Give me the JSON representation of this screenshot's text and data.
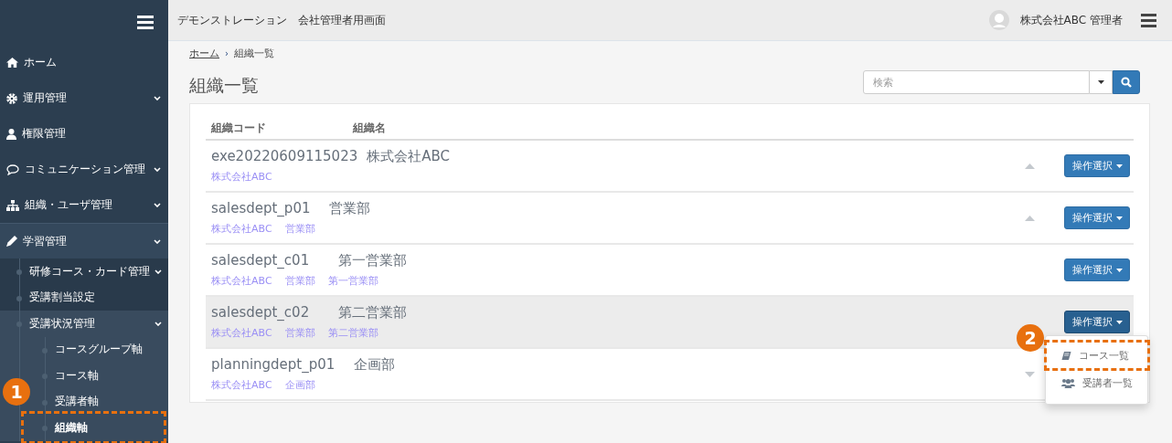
{
  "sidebar": {
    "items": [
      {
        "label": "ホーム"
      },
      {
        "label": "運用管理",
        "expanded": false
      },
      {
        "label": "権限管理"
      },
      {
        "label": "コミュニケーション管理",
        "expanded": false
      },
      {
        "label": "組織・ユーザ管理",
        "expanded": false
      },
      {
        "label": "学習管理",
        "expanded": true,
        "children": [
          {
            "label": "研修コース・カード管理",
            "expanded": false
          },
          {
            "label": "受講割当設定"
          },
          {
            "label": "受講状況管理",
            "expanded": true,
            "children": [
              {
                "label": "コースグループ軸",
                "selected": false
              },
              {
                "label": "コース軸",
                "selected": false
              },
              {
                "label": "受講者軸",
                "selected": false
              },
              {
                "label": "組織軸",
                "selected": true,
                "callout": "1"
              }
            ]
          }
        ]
      }
    ]
  },
  "header": {
    "title": "デモンストレーション",
    "subtitle": "会社管理者用画面",
    "user": "株式会社ABC 管理者"
  },
  "breadcrumb": {
    "link": "ホーム",
    "separator": "›",
    "current": "組織一覧"
  },
  "page_title": "組織一覧",
  "search": {
    "placeholder": "検索"
  },
  "table": {
    "columns": [
      "組織コード",
      "組織名"
    ],
    "rows": [
      {
        "code": "exe20220609115023",
        "name": "株式会社ABC",
        "path": [
          "株式会社ABC"
        ],
        "expanded": true,
        "selected": false,
        "button": "操作選択",
        "open": false,
        "children": [
          {
            "code": "salesdept_p01",
            "name": "営業部",
            "path": [
              "株式会社ABC",
              "営業部"
            ],
            "expanded": true,
            "selected": false,
            "button": "操作選択",
            "open": false,
            "children": [
              {
                "code": "salesdept_c01",
                "name": "第一営業部",
                "path": [
                  "株式会社ABC",
                  "営業部",
                  "第一営業部"
                ],
                "selected": false,
                "button": "操作選択",
                "open": false
              },
              {
                "code": "salesdept_c02",
                "name": "第二営業部",
                "path": [
                  "株式会社ABC",
                  "営業部",
                  "第二営業部"
                ],
                "selected": true,
                "button": "操作選択",
                "open": true,
                "callout": "2",
                "menu": [
                  {
                    "label": "コース一覧",
                    "kind": "course",
                    "callout": true
                  },
                  {
                    "label": "受講者一覧",
                    "kind": "users",
                    "callout": false
                  }
                ]
              }
            ]
          },
          {
            "code": "planningdept_p01",
            "name": "企画部",
            "path": [
              "株式会社ABC",
              "企画部"
            ],
            "expanded": false,
            "selected": false
          }
        ]
      }
    ]
  }
}
